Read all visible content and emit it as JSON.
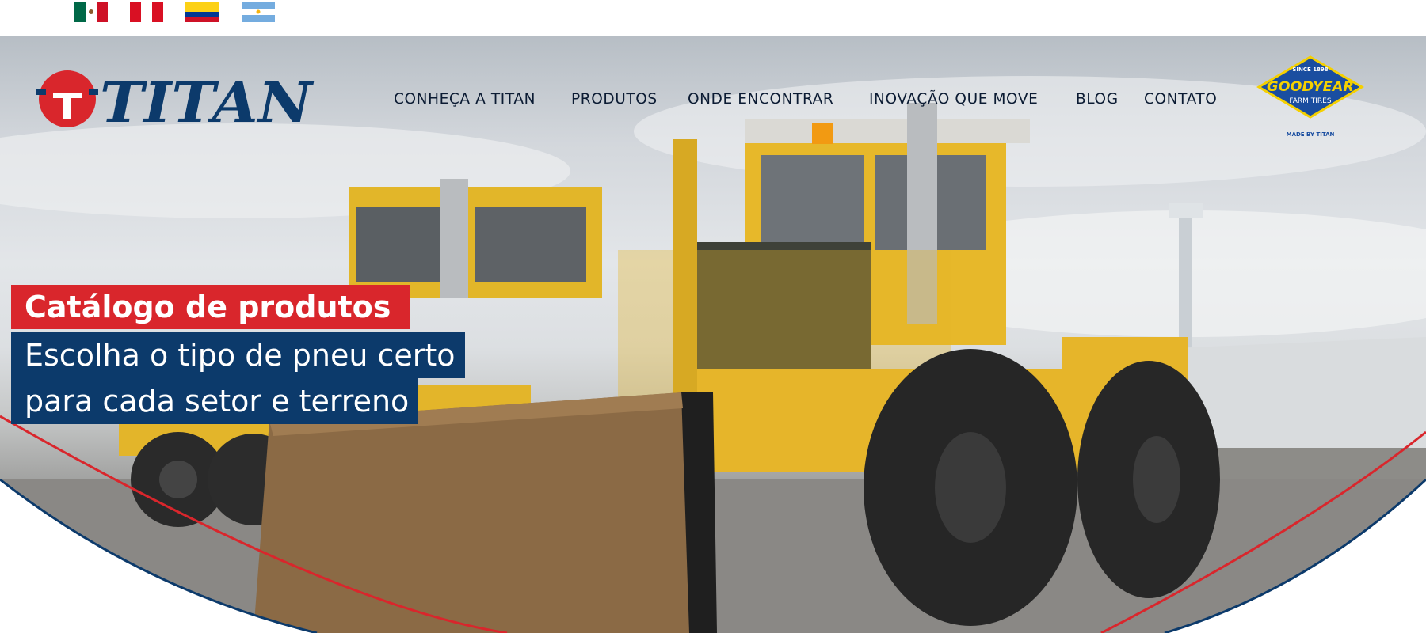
{
  "flags": [
    {
      "name": "Mexico",
      "colors": [
        "#006847",
        "#ffffff",
        "#ce1126"
      ]
    },
    {
      "name": "Peru",
      "colors": [
        "#d91023",
        "#ffffff",
        "#d91023"
      ]
    },
    {
      "name": "Colombia",
      "colors": [
        "#fcd116",
        "#003893",
        "#ce1126"
      ]
    },
    {
      "name": "Argentina",
      "colors": [
        "#74acdf",
        "#ffffff",
        "#74acdf"
      ]
    }
  ],
  "header": {
    "logo_text": "TITAN",
    "nav": [
      {
        "label": "CONHEÇA A TITAN"
      },
      {
        "label": "PRODUTOS"
      },
      {
        "label": "ONDE ENCONTRAR"
      },
      {
        "label": "INOVAÇÃO QUE MOVE"
      },
      {
        "label": "BLOG"
      },
      {
        "label": "CONTATO"
      }
    ],
    "partner_logo": {
      "since": "SINCE 1898",
      "brand": "GOODYEAR",
      "sub": "FARM TIRES",
      "made_by": "MADE BY TITAN"
    }
  },
  "hero": {
    "title": "Catálogo de produtos",
    "subtitle_line1": "Escolha o tipo de pneu certo",
    "subtitle_line2": "para cada setor e terreno"
  },
  "colors": {
    "titan_red": "#d9262c",
    "titan_blue": "#0c3a6b",
    "nav_text": "#0b1b33",
    "goodyear_blue": "#1a4ea0",
    "goodyear_yellow": "#f5d000"
  }
}
